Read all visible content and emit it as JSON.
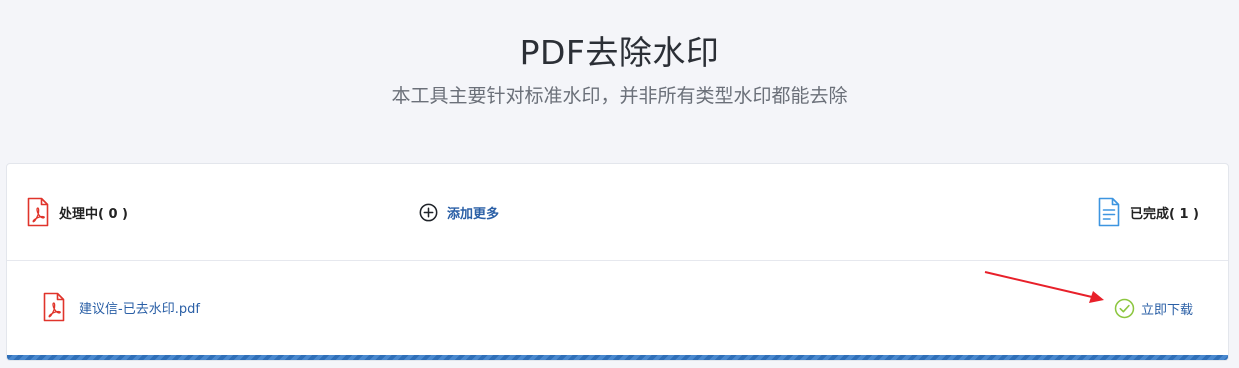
{
  "header": {
    "title": "PDF去除水印",
    "subtitle": "本工具主要针对标准水印，并非所有类型水印都能去除"
  },
  "panel": {
    "processing_label": "处理中( 0 )",
    "add_more_label": "添加更多",
    "completed_label": "已完成( 1 )",
    "files": [
      {
        "name": "建议信-已去水印.pdf",
        "action_label": "立即下载"
      }
    ],
    "progress_percent": 100
  },
  "colors": {
    "background": "#f4f5f9",
    "pdf_red": "#e0342b",
    "link_blue": "#2a5fa6",
    "doc_blue": "#3d95e0",
    "check_green": "#8cc63f",
    "progress_blue": "#2f6fb8",
    "arrow_red": "#e8202a"
  },
  "icons": {
    "processing": "pdf-file-icon",
    "add_more": "plus-circle-icon",
    "completed": "document-icon",
    "file": "pdf-file-icon",
    "download": "check-circle-icon"
  }
}
